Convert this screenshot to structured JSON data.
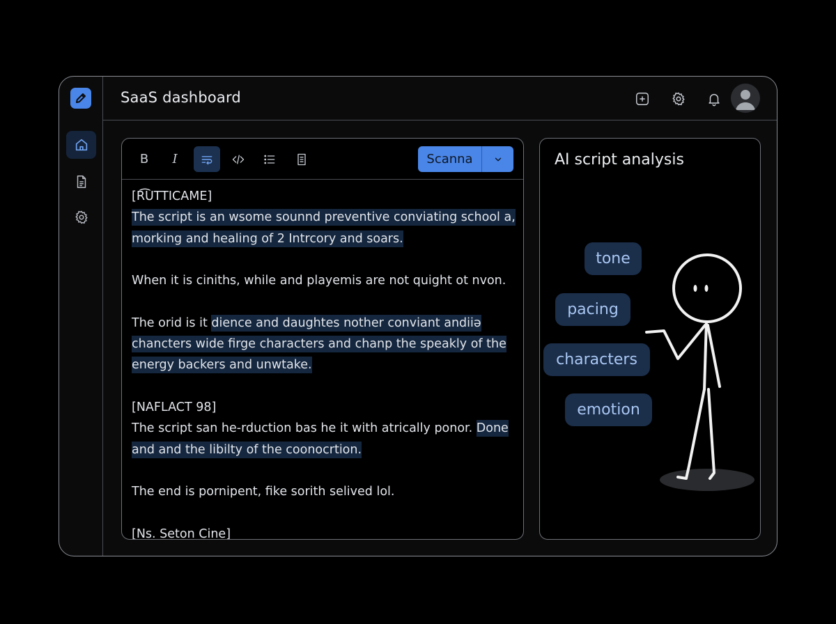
{
  "header": {
    "title": "SaaS dashboard"
  },
  "sidebar": {
    "items": [
      {
        "name": "home",
        "icon": "home-icon"
      },
      {
        "name": "documents",
        "icon": "document-icon"
      },
      {
        "name": "settings",
        "icon": "gear-icon"
      }
    ]
  },
  "topbar_icons": [
    "add-icon",
    "gear-icon",
    "bell-icon",
    "avatar"
  ],
  "editor": {
    "toolbar": {
      "tools": [
        "bold",
        "italic",
        "wrap",
        "code",
        "list",
        "document"
      ],
      "bold_label": "B",
      "italic_label": "I",
      "scan_label": "Scanna"
    },
    "lines": [
      {
        "text": "[R͡UTTICAME]",
        "highlight": false
      },
      {
        "text": "The script is an wsome sounnd preventive conviating school a,",
        "highlight": true
      },
      {
        "text": "morking and healing of 2 Intrcory and soars.",
        "highlight": true
      },
      {
        "text": "",
        "highlight": false
      },
      {
        "text": "When it is ciniths, while and playemis are not quight ot nvon.",
        "highlight": false
      },
      {
        "text": "",
        "highlight": false
      },
      {
        "pre": "The orid is it ",
        "text": "dience and daughtes nother conviant andiiə",
        "highlight": true
      },
      {
        "text": "chancters wide firge characters and chanp the speakly of the",
        "highlight": true
      },
      {
        "text": "energy backers and unwtake.",
        "highlight": true
      },
      {
        "text": "",
        "highlight": false
      },
      {
        "text": "[NAFLACT 98]",
        "highlight": false
      },
      {
        "pre": "The script san he-rduction bas he it with atrically ponor. ",
        "text": "Done",
        "highlight": true
      },
      {
        "text": "and and the libilty of the coonocrtion.",
        "highlight": true
      },
      {
        "text": "",
        "highlight": false
      },
      {
        "text": "The end is pornipent, fike sorith selived lol.",
        "highlight": false
      },
      {
        "text": "",
        "highlight": false
      },
      {
        "text": "[Ns. Seton Cine]",
        "highlight": false
      }
    ]
  },
  "analysis": {
    "title": "AI script analysis",
    "tags": [
      "tone",
      "pacing",
      "characters",
      "emotion"
    ]
  },
  "colors": {
    "accent": "#4a86e8",
    "highlight": "#15273f",
    "tag_bg": "#1b2e4a",
    "tag_text": "#a9c7f3"
  }
}
